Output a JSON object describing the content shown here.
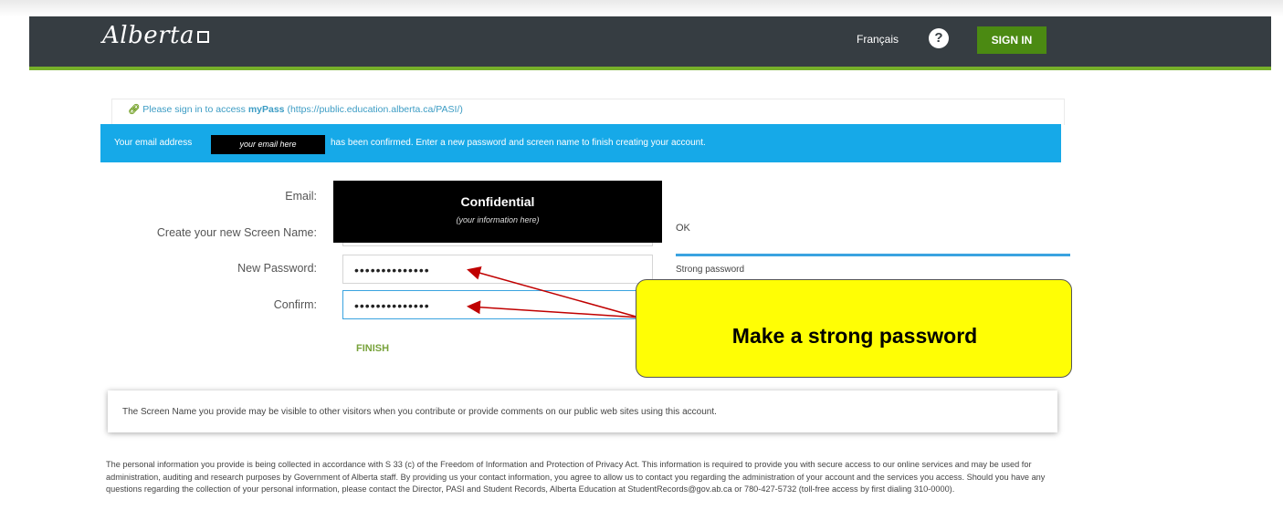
{
  "header": {
    "logo_text": "Alberta",
    "language_link": "Français",
    "help_icon": "question-circle-icon",
    "help_symbol": "?",
    "sign_in_label": "SIGN IN"
  },
  "notice": {
    "icon": "link-icon",
    "prefix": "Please sign in to access ",
    "app_name": "myPass",
    "url": " (https://public.education.alberta.ca/PASI/)"
  },
  "banner": {
    "text_before": "Your email address",
    "redacted_email": "your email here",
    "text_after": "has been confirmed. Enter a new password and screen name to finish creating your account."
  },
  "form": {
    "email_label": "Email:",
    "screen_name_label": "Create your new Screen Name:",
    "new_password_label": "New Password:",
    "new_password_value": "••••••••••••••",
    "confirm_label": "Confirm:",
    "confirm_value": "••••••••••••••",
    "redaction_title": "Confidential",
    "redaction_subtitle": "(your information here)",
    "screen_name_status": "OK",
    "password_strength": "Strong password",
    "finish_label": "FINISH"
  },
  "callout": {
    "text": "Make a strong password"
  },
  "info_box": {
    "text": "The Screen Name you provide may be visible to other visitors when you contribute or provide comments on our public web sites using this account."
  },
  "privacy": {
    "text": "The personal information you provide is being collected in accordance with S 33 (c) of the Freedom of Information and Protection of Privacy Act. This information is required to provide you with secure access to our online services and may be used for administration, auditing and research purposes by Government of Alberta staff. By providing us your contact information, you agree to allow us to contact you regarding the administration of your account and the services you access. Should you have any questions regarding the collection of your personal information, please contact the Director, PASI and Student Records, Alberta Education at StudentRecords@gov.ab.ca or 780-427-5732 (toll-free access by first dialing 310-0000)."
  },
  "colors": {
    "header_bg": "#363d42",
    "accent_green": "#77b02a",
    "sign_in_bg": "#4b8a12",
    "banner_blue": "#16a9e8",
    "callout_yellow": "#fffe05",
    "arrow_red": "#c00000"
  }
}
